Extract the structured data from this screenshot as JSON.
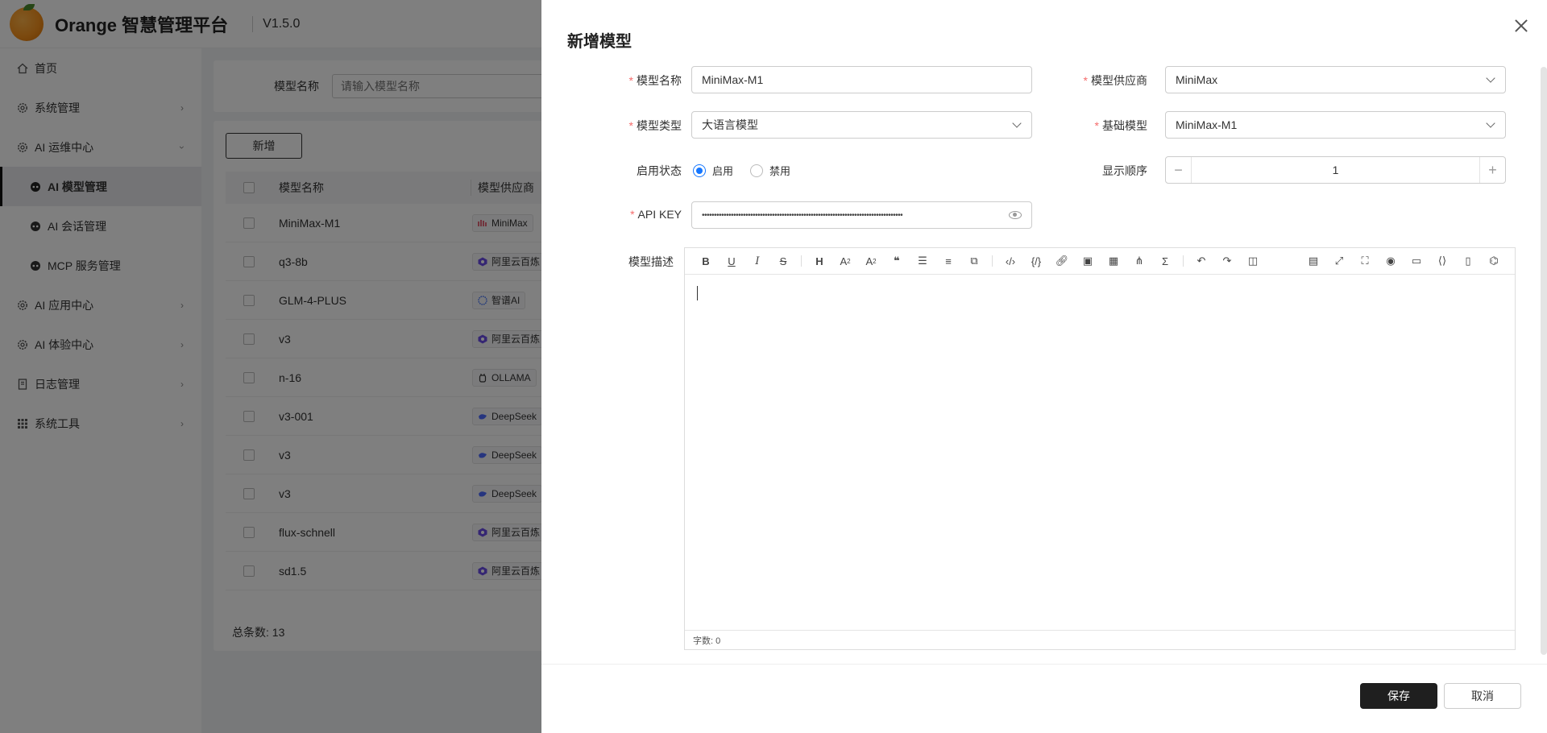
{
  "app": {
    "title": "Orange 智慧管理平台",
    "version": "V1.5.0"
  },
  "sidebar": {
    "items": [
      {
        "label": "首页",
        "icon": "home-icon"
      },
      {
        "label": "系统管理",
        "icon": "gear-icon"
      },
      {
        "label": "AI 运维中心",
        "icon": "gear-icon"
      },
      {
        "label": "AI 模型管理",
        "icon": "robot-icon"
      },
      {
        "label": "AI 会话管理",
        "icon": "robot-icon"
      },
      {
        "label": "MCP 服务管理",
        "icon": "robot-icon"
      },
      {
        "label": "AI 应用中心",
        "icon": "gear-icon"
      },
      {
        "label": "AI 体验中心",
        "icon": "gear-icon"
      },
      {
        "label": "日志管理",
        "icon": "document-icon"
      },
      {
        "label": "系统工具",
        "icon": "grid-icon"
      }
    ]
  },
  "search": {
    "label": "模型名称",
    "placeholder": "请输入模型名称"
  },
  "table": {
    "add_label": "新增",
    "headers": [
      "模型名称",
      "模型供应商"
    ],
    "rows": [
      {
        "name": "MiniMax-M1",
        "provider": "MiniMax"
      },
      {
        "name": "q3-8b",
        "provider": "阿里云百炼"
      },
      {
        "name": "GLM-4-PLUS",
        "provider": "智谱AI"
      },
      {
        "name": "v3",
        "provider": "阿里云百炼"
      },
      {
        "name": "n-16",
        "provider": "OLLAMA"
      },
      {
        "name": "v3-001",
        "provider": "DeepSeek"
      },
      {
        "name": "v3",
        "provider": "DeepSeek"
      },
      {
        "name": "v3",
        "provider": "DeepSeek"
      },
      {
        "name": "flux-schnell",
        "provider": "阿里云百炼"
      },
      {
        "name": "sd1.5",
        "provider": "阿里云百炼"
      }
    ],
    "total": "总条数: 13"
  },
  "drawer": {
    "title": "新增模型",
    "fields": {
      "name": {
        "label": "模型名称",
        "value": "MiniMax-M1"
      },
      "provider": {
        "label": "模型供应商",
        "value": "MiniMax"
      },
      "type": {
        "label": "模型类型",
        "value": "大语言模型"
      },
      "base": {
        "label": "基础模型",
        "value": "MiniMax-M1"
      },
      "status": {
        "label": "启用状态",
        "options": [
          "启用",
          "禁用"
        ],
        "selected": "启用"
      },
      "order": {
        "label": "显示顺序",
        "value": "1"
      },
      "apikey": {
        "label": "API KEY",
        "value": "•••••••••••••••••••••••••••••••••••••••••••••••••••••••••••••••••••••••••••••••••••"
      },
      "desc": {
        "label": "模型描述"
      }
    },
    "editor": {
      "word_count": "字数: 0"
    },
    "save_label": "保存",
    "cancel_label": "取消"
  },
  "colors": {
    "accent": "#1677ff",
    "primary_button": "#1f1f1f",
    "required": "#f56c6c"
  }
}
